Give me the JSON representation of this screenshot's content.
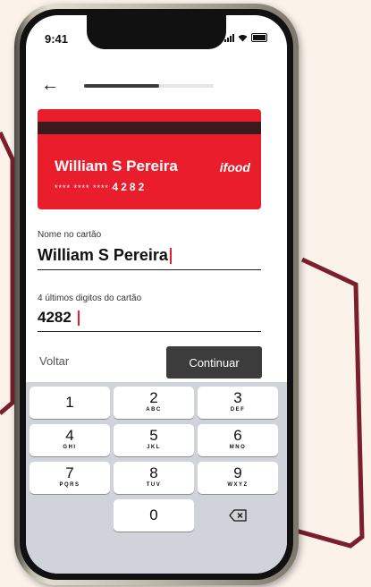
{
  "status_bar": {
    "time": "9:41"
  },
  "progress": {
    "value": 0.58
  },
  "card": {
    "name": "William S Pereira",
    "number_masked": "**** **** ****",
    "number_last": "4282",
    "logo": "ifood",
    "color": "#ea1d2c"
  },
  "form": {
    "name_label": "Nome no cartão",
    "name_value": "William S Pereira",
    "digits_label": "4 últimos digitos do cartão",
    "digits_value": "4282"
  },
  "actions": {
    "back_label": "Voltar",
    "continue_label": "Continuar"
  },
  "keypad": {
    "keys": [
      {
        "digit": "1",
        "letters": ""
      },
      {
        "digit": "2",
        "letters": "ABC"
      },
      {
        "digit": "3",
        "letters": "DEF"
      },
      {
        "digit": "4",
        "letters": "GHI"
      },
      {
        "digit": "5",
        "letters": "JKL"
      },
      {
        "digit": "6",
        "letters": "MNO"
      },
      {
        "digit": "7",
        "letters": "PQRS"
      },
      {
        "digit": "8",
        "letters": "TUV"
      },
      {
        "digit": "9",
        "letters": "WXYZ"
      },
      {
        "digit": "0",
        "letters": ""
      }
    ],
    "delete_icon": "backspace-icon"
  },
  "colors": {
    "background": "#fbf3ea",
    "accent": "#ea1d2c",
    "decor": "#7a1f2b"
  }
}
